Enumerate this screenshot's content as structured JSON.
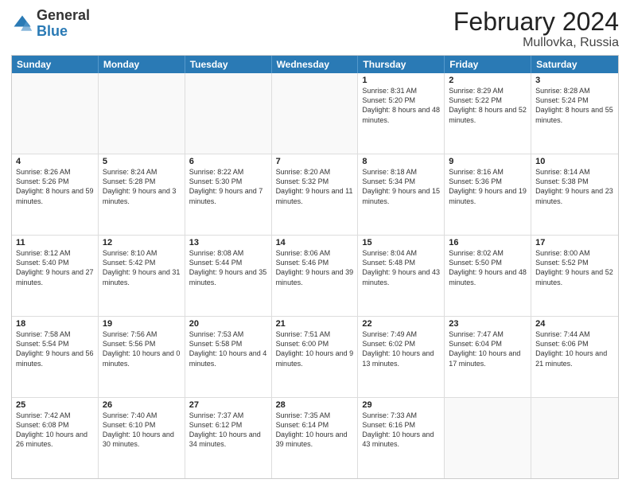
{
  "logo": {
    "general": "General",
    "blue": "Blue"
  },
  "title": {
    "month_year": "February 2024",
    "location": "Mullovka, Russia"
  },
  "header_days": [
    "Sunday",
    "Monday",
    "Tuesday",
    "Wednesday",
    "Thursday",
    "Friday",
    "Saturday"
  ],
  "weeks": [
    [
      {
        "day": "",
        "text": "",
        "empty": true
      },
      {
        "day": "",
        "text": "",
        "empty": true
      },
      {
        "day": "",
        "text": "",
        "empty": true
      },
      {
        "day": "",
        "text": "",
        "empty": true
      },
      {
        "day": "1",
        "text": "Sunrise: 8:31 AM\nSunset: 5:20 PM\nDaylight: 8 hours\nand 48 minutes."
      },
      {
        "day": "2",
        "text": "Sunrise: 8:29 AM\nSunset: 5:22 PM\nDaylight: 8 hours\nand 52 minutes."
      },
      {
        "day": "3",
        "text": "Sunrise: 8:28 AM\nSunset: 5:24 PM\nDaylight: 8 hours\nand 55 minutes."
      }
    ],
    [
      {
        "day": "4",
        "text": "Sunrise: 8:26 AM\nSunset: 5:26 PM\nDaylight: 8 hours\nand 59 minutes."
      },
      {
        "day": "5",
        "text": "Sunrise: 8:24 AM\nSunset: 5:28 PM\nDaylight: 9 hours\nand 3 minutes."
      },
      {
        "day": "6",
        "text": "Sunrise: 8:22 AM\nSunset: 5:30 PM\nDaylight: 9 hours\nand 7 minutes."
      },
      {
        "day": "7",
        "text": "Sunrise: 8:20 AM\nSunset: 5:32 PM\nDaylight: 9 hours\nand 11 minutes."
      },
      {
        "day": "8",
        "text": "Sunrise: 8:18 AM\nSunset: 5:34 PM\nDaylight: 9 hours\nand 15 minutes."
      },
      {
        "day": "9",
        "text": "Sunrise: 8:16 AM\nSunset: 5:36 PM\nDaylight: 9 hours\nand 19 minutes."
      },
      {
        "day": "10",
        "text": "Sunrise: 8:14 AM\nSunset: 5:38 PM\nDaylight: 9 hours\nand 23 minutes."
      }
    ],
    [
      {
        "day": "11",
        "text": "Sunrise: 8:12 AM\nSunset: 5:40 PM\nDaylight: 9 hours\nand 27 minutes."
      },
      {
        "day": "12",
        "text": "Sunrise: 8:10 AM\nSunset: 5:42 PM\nDaylight: 9 hours\nand 31 minutes."
      },
      {
        "day": "13",
        "text": "Sunrise: 8:08 AM\nSunset: 5:44 PM\nDaylight: 9 hours\nand 35 minutes."
      },
      {
        "day": "14",
        "text": "Sunrise: 8:06 AM\nSunset: 5:46 PM\nDaylight: 9 hours\nand 39 minutes."
      },
      {
        "day": "15",
        "text": "Sunrise: 8:04 AM\nSunset: 5:48 PM\nDaylight: 9 hours\nand 43 minutes."
      },
      {
        "day": "16",
        "text": "Sunrise: 8:02 AM\nSunset: 5:50 PM\nDaylight: 9 hours\nand 48 minutes."
      },
      {
        "day": "17",
        "text": "Sunrise: 8:00 AM\nSunset: 5:52 PM\nDaylight: 9 hours\nand 52 minutes."
      }
    ],
    [
      {
        "day": "18",
        "text": "Sunrise: 7:58 AM\nSunset: 5:54 PM\nDaylight: 9 hours\nand 56 minutes."
      },
      {
        "day": "19",
        "text": "Sunrise: 7:56 AM\nSunset: 5:56 PM\nDaylight: 10 hours\nand 0 minutes."
      },
      {
        "day": "20",
        "text": "Sunrise: 7:53 AM\nSunset: 5:58 PM\nDaylight: 10 hours\nand 4 minutes."
      },
      {
        "day": "21",
        "text": "Sunrise: 7:51 AM\nSunset: 6:00 PM\nDaylight: 10 hours\nand 9 minutes."
      },
      {
        "day": "22",
        "text": "Sunrise: 7:49 AM\nSunset: 6:02 PM\nDaylight: 10 hours\nand 13 minutes."
      },
      {
        "day": "23",
        "text": "Sunrise: 7:47 AM\nSunset: 6:04 PM\nDaylight: 10 hours\nand 17 minutes."
      },
      {
        "day": "24",
        "text": "Sunrise: 7:44 AM\nSunset: 6:06 PM\nDaylight: 10 hours\nand 21 minutes."
      }
    ],
    [
      {
        "day": "25",
        "text": "Sunrise: 7:42 AM\nSunset: 6:08 PM\nDaylight: 10 hours\nand 26 minutes."
      },
      {
        "day": "26",
        "text": "Sunrise: 7:40 AM\nSunset: 6:10 PM\nDaylight: 10 hours\nand 30 minutes."
      },
      {
        "day": "27",
        "text": "Sunrise: 7:37 AM\nSunset: 6:12 PM\nDaylight: 10 hours\nand 34 minutes."
      },
      {
        "day": "28",
        "text": "Sunrise: 7:35 AM\nSunset: 6:14 PM\nDaylight: 10 hours\nand 39 minutes."
      },
      {
        "day": "29",
        "text": "Sunrise: 7:33 AM\nSunset: 6:16 PM\nDaylight: 10 hours\nand 43 minutes."
      },
      {
        "day": "",
        "text": "",
        "empty": true
      },
      {
        "day": "",
        "text": "",
        "empty": true
      }
    ]
  ]
}
